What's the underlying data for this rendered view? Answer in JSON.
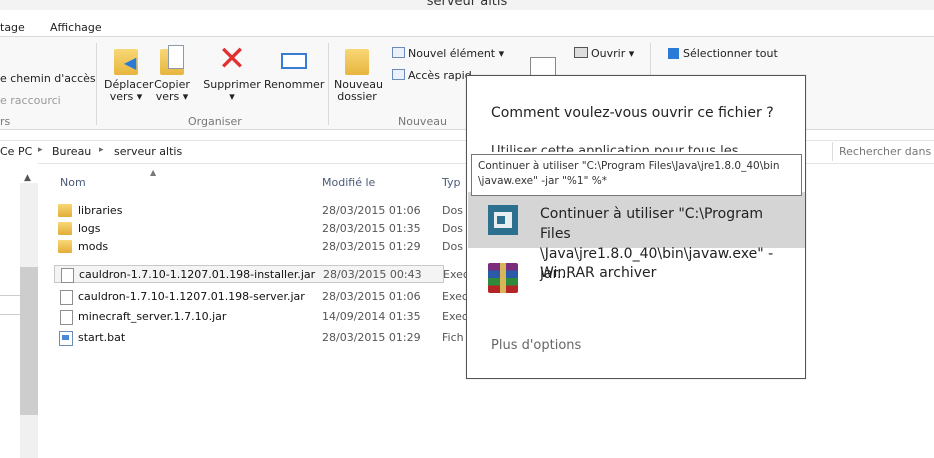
{
  "window": {
    "title": "serveur altis"
  },
  "menu": {
    "items": [
      "tage",
      "Affichage"
    ]
  },
  "ribbon": {
    "clipboard_small": [
      "e chemin d'accès",
      "e raccourci"
    ],
    "clipboard_group_label": "rs",
    "organize": {
      "move_label": "Déplacer",
      "move_sub": "vers ▾",
      "copy_label": "Copier",
      "copy_sub": "vers ▾",
      "delete_label": "Supprimer",
      "delete_sub": "▾",
      "rename_label": "Renommer",
      "group_label": "Organiser"
    },
    "new": {
      "new_folder_line1": "Nouveau",
      "new_folder_line2": "dossier",
      "new_item": "Nouvel élément ▾",
      "easy_access": "Accès rapid",
      "group_label": "Nouveau"
    },
    "open": {
      "open_label": "Ouvrir ▾"
    },
    "select": {
      "select_all": "Sélectionner tout"
    }
  },
  "address": {
    "crumbs": [
      "Ce PC",
      "Bureau",
      "serveur altis"
    ],
    "search_placeholder": "Rechercher dans :"
  },
  "columns": {
    "name": "Nom",
    "modified": "Modifié le",
    "type": "Typ"
  },
  "files": [
    {
      "name": "libraries",
      "date": "28/03/2015 01:06",
      "type": "Dos",
      "kind": "folder"
    },
    {
      "name": "logs",
      "date": "28/03/2015 01:35",
      "type": "Dos",
      "kind": "folder"
    },
    {
      "name": "mods",
      "date": "28/03/2015 01:29",
      "type": "Dos",
      "kind": "folder"
    },
    {
      "name": "cauldron-1.7.10-1.1207.01.198-installer.jar",
      "date": "28/03/2015 00:43",
      "type": "Exec",
      "kind": "doc",
      "selected": true
    },
    {
      "name": "cauldron-1.7.10-1.1207.01.198-server.jar",
      "date": "28/03/2015 01:06",
      "type": "Exec",
      "kind": "doc"
    },
    {
      "name": "minecraft_server.1.7.10.jar",
      "date": "14/09/2014 01:35",
      "type": "Exec",
      "kind": "doc"
    },
    {
      "name": "start.bat",
      "date": "28/03/2015 01:29",
      "type": "Fich",
      "kind": "bat"
    }
  ],
  "dialog": {
    "title": "Comment voulez-vous ouvrir ce fichier ?",
    "checkbox_label": "Utiliser cette application pour tous les",
    "options": [
      {
        "label": "Continuer à utiliser \"C:\\Program Files \\Java\\jre1.8.0_40\\bin\\javaw.exe\" -jar...",
        "icon": "java-app-icon"
      },
      {
        "label": "WinRAR archiver",
        "icon": "winrar-icon"
      }
    ],
    "more_options": "Plus d'options"
  },
  "tooltip": {
    "line1": "Continuer à utiliser \"C:\\Program Files\\Java\\jre1.8.0_40\\bin",
    "line2": "\\javaw.exe\" -jar \"%1\" %*"
  }
}
